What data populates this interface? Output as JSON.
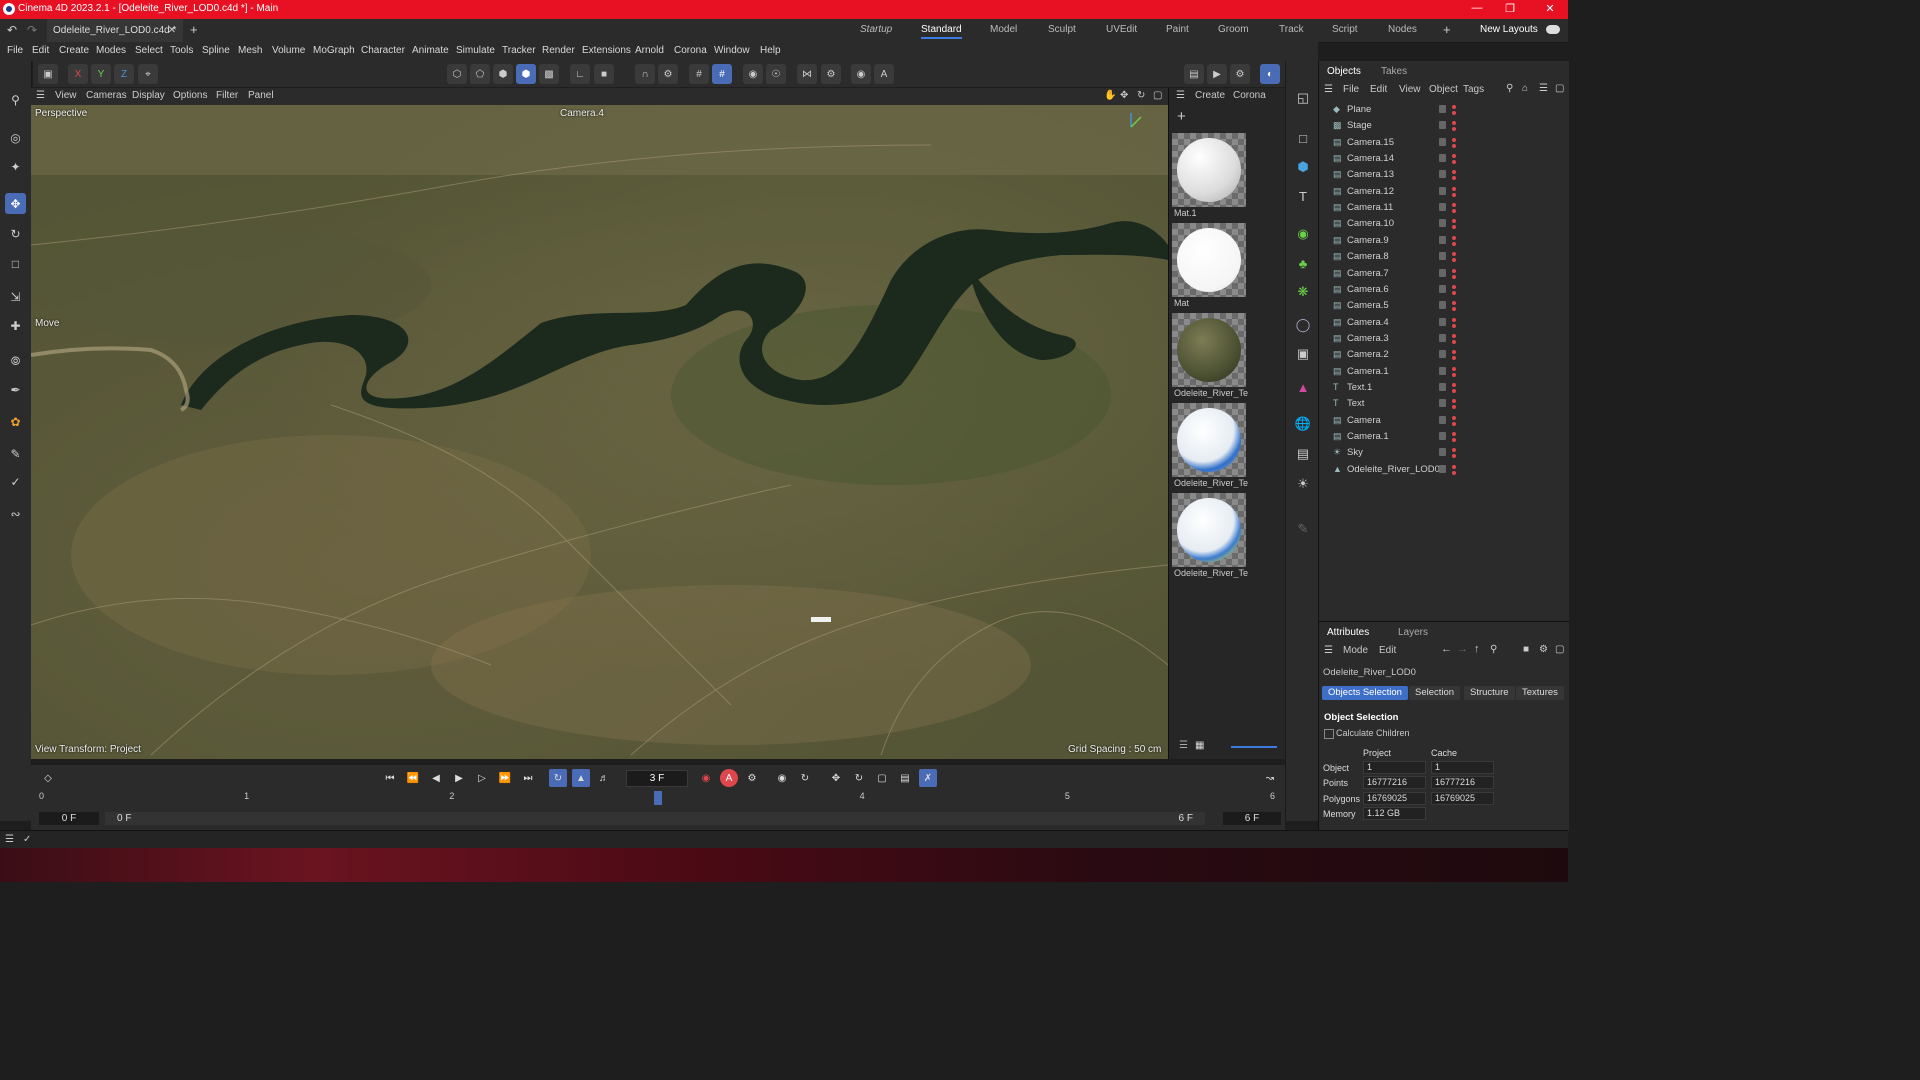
{
  "app": {
    "title": "Cinema 4D 2023.2.1 - [Odeleite_River_LOD0.c4d *] - Main",
    "doc_tab": "Odeleite_River_LOD0.c4d *",
    "layouts": [
      "Startup",
      "Standard",
      "Model",
      "Sculpt",
      "UVEdit",
      "Paint",
      "Groom",
      "Track",
      "Script",
      "Nodes"
    ],
    "active_layout": "Standard",
    "new_layouts": "New Layouts"
  },
  "menu": [
    "File",
    "Edit",
    "Create",
    "Modes",
    "Select",
    "Tools",
    "Spline",
    "Mesh",
    "Volume",
    "MoGraph",
    "Character",
    "Animate",
    "Simulate",
    "Tracker",
    "Render",
    "Extensions",
    "Arnold",
    "Corona",
    "Window",
    "Help"
  ],
  "axis": {
    "x": "X",
    "y": "Y",
    "z": "Z"
  },
  "viewport": {
    "menu": [
      "View",
      "Cameras",
      "Display",
      "Options",
      "Filter",
      "Panel"
    ],
    "label": "Perspective",
    "camera": "Camera.4",
    "tool": "Move",
    "view_transform": "View Transform: Project",
    "grid_spacing": "Grid Spacing : 50 cm"
  },
  "materials": {
    "menu": [
      "Create",
      "Corona"
    ],
    "items": [
      {
        "name": "Mat.1"
      },
      {
        "name": "Mat"
      },
      {
        "name": "Odeleite_River_Te"
      },
      {
        "name": "Odeleite_River_Te"
      },
      {
        "name": "Odeleite_River_Te"
      }
    ]
  },
  "objects": {
    "tabs": [
      "Objects",
      "Takes"
    ],
    "menu": [
      "File",
      "Edit",
      "View",
      "Object",
      "Tags"
    ],
    "items": [
      {
        "name": "Plane",
        "icon": "plane-icon"
      },
      {
        "name": "Stage",
        "icon": "stage-icon"
      },
      {
        "name": "Camera.15",
        "icon": "camera-icon"
      },
      {
        "name": "Camera.14",
        "icon": "camera-icon"
      },
      {
        "name": "Camera.13",
        "icon": "camera-icon"
      },
      {
        "name": "Camera.12",
        "icon": "camera-icon"
      },
      {
        "name": "Camera.11",
        "icon": "camera-icon"
      },
      {
        "name": "Camera.10",
        "icon": "camera-icon"
      },
      {
        "name": "Camera.9",
        "icon": "camera-icon"
      },
      {
        "name": "Camera.8",
        "icon": "camera-icon"
      },
      {
        "name": "Camera.7",
        "icon": "camera-icon"
      },
      {
        "name": "Camera.6",
        "icon": "camera-icon"
      },
      {
        "name": "Camera.5",
        "icon": "camera-icon"
      },
      {
        "name": "Camera.4",
        "icon": "camera-icon"
      },
      {
        "name": "Camera.3",
        "icon": "camera-icon"
      },
      {
        "name": "Camera.2",
        "icon": "camera-icon"
      },
      {
        "name": "Camera.1",
        "icon": "camera-icon"
      },
      {
        "name": "Text.1",
        "icon": "text-icon"
      },
      {
        "name": "Text",
        "icon": "text-icon"
      },
      {
        "name": "Camera",
        "icon": "camera-icon"
      },
      {
        "name": "Camera.1",
        "icon": "camera-icon"
      },
      {
        "name": "Sky",
        "icon": "sky-icon"
      },
      {
        "name": "Odeleite_River_LOD0",
        "icon": "polygon-object-icon"
      }
    ]
  },
  "attributes": {
    "tabs": [
      "Attributes",
      "Layers"
    ],
    "menu": [
      "Mode",
      "Edit"
    ],
    "object_name": "Odeleite_River_LOD0",
    "buttons": [
      "Objects Selection",
      "Selection",
      "Structure",
      "Textures"
    ],
    "section": "Object Selection",
    "calculate_children": "Calculate Children",
    "col_project": "Project",
    "col_cache": "Cache",
    "rows": [
      {
        "label": "Object",
        "project": "1",
        "cache": "1"
      },
      {
        "label": "Points",
        "project": "16777216",
        "cache": "16777216"
      },
      {
        "label": "Polygons",
        "project": "16769025",
        "cache": "16769025"
      },
      {
        "label": "Memory",
        "project": "1.12 GB",
        "cache": ""
      }
    ]
  },
  "timeline": {
    "current_frame": "3 F",
    "start": "0 F",
    "start2": "0 F",
    "end": "6 F",
    "end2": "6 F",
    "ruler": [
      "0",
      "1",
      "2",
      "3",
      "4",
      "5",
      "6"
    ],
    "playhead": 3,
    "max_frame": 6
  },
  "colors": {
    "accent": "#3d7be0",
    "titlebar": "#e81123",
    "x_axis": "#e0474c",
    "y_axis": "#6ad04a",
    "z_axis": "#4a8fe0"
  }
}
